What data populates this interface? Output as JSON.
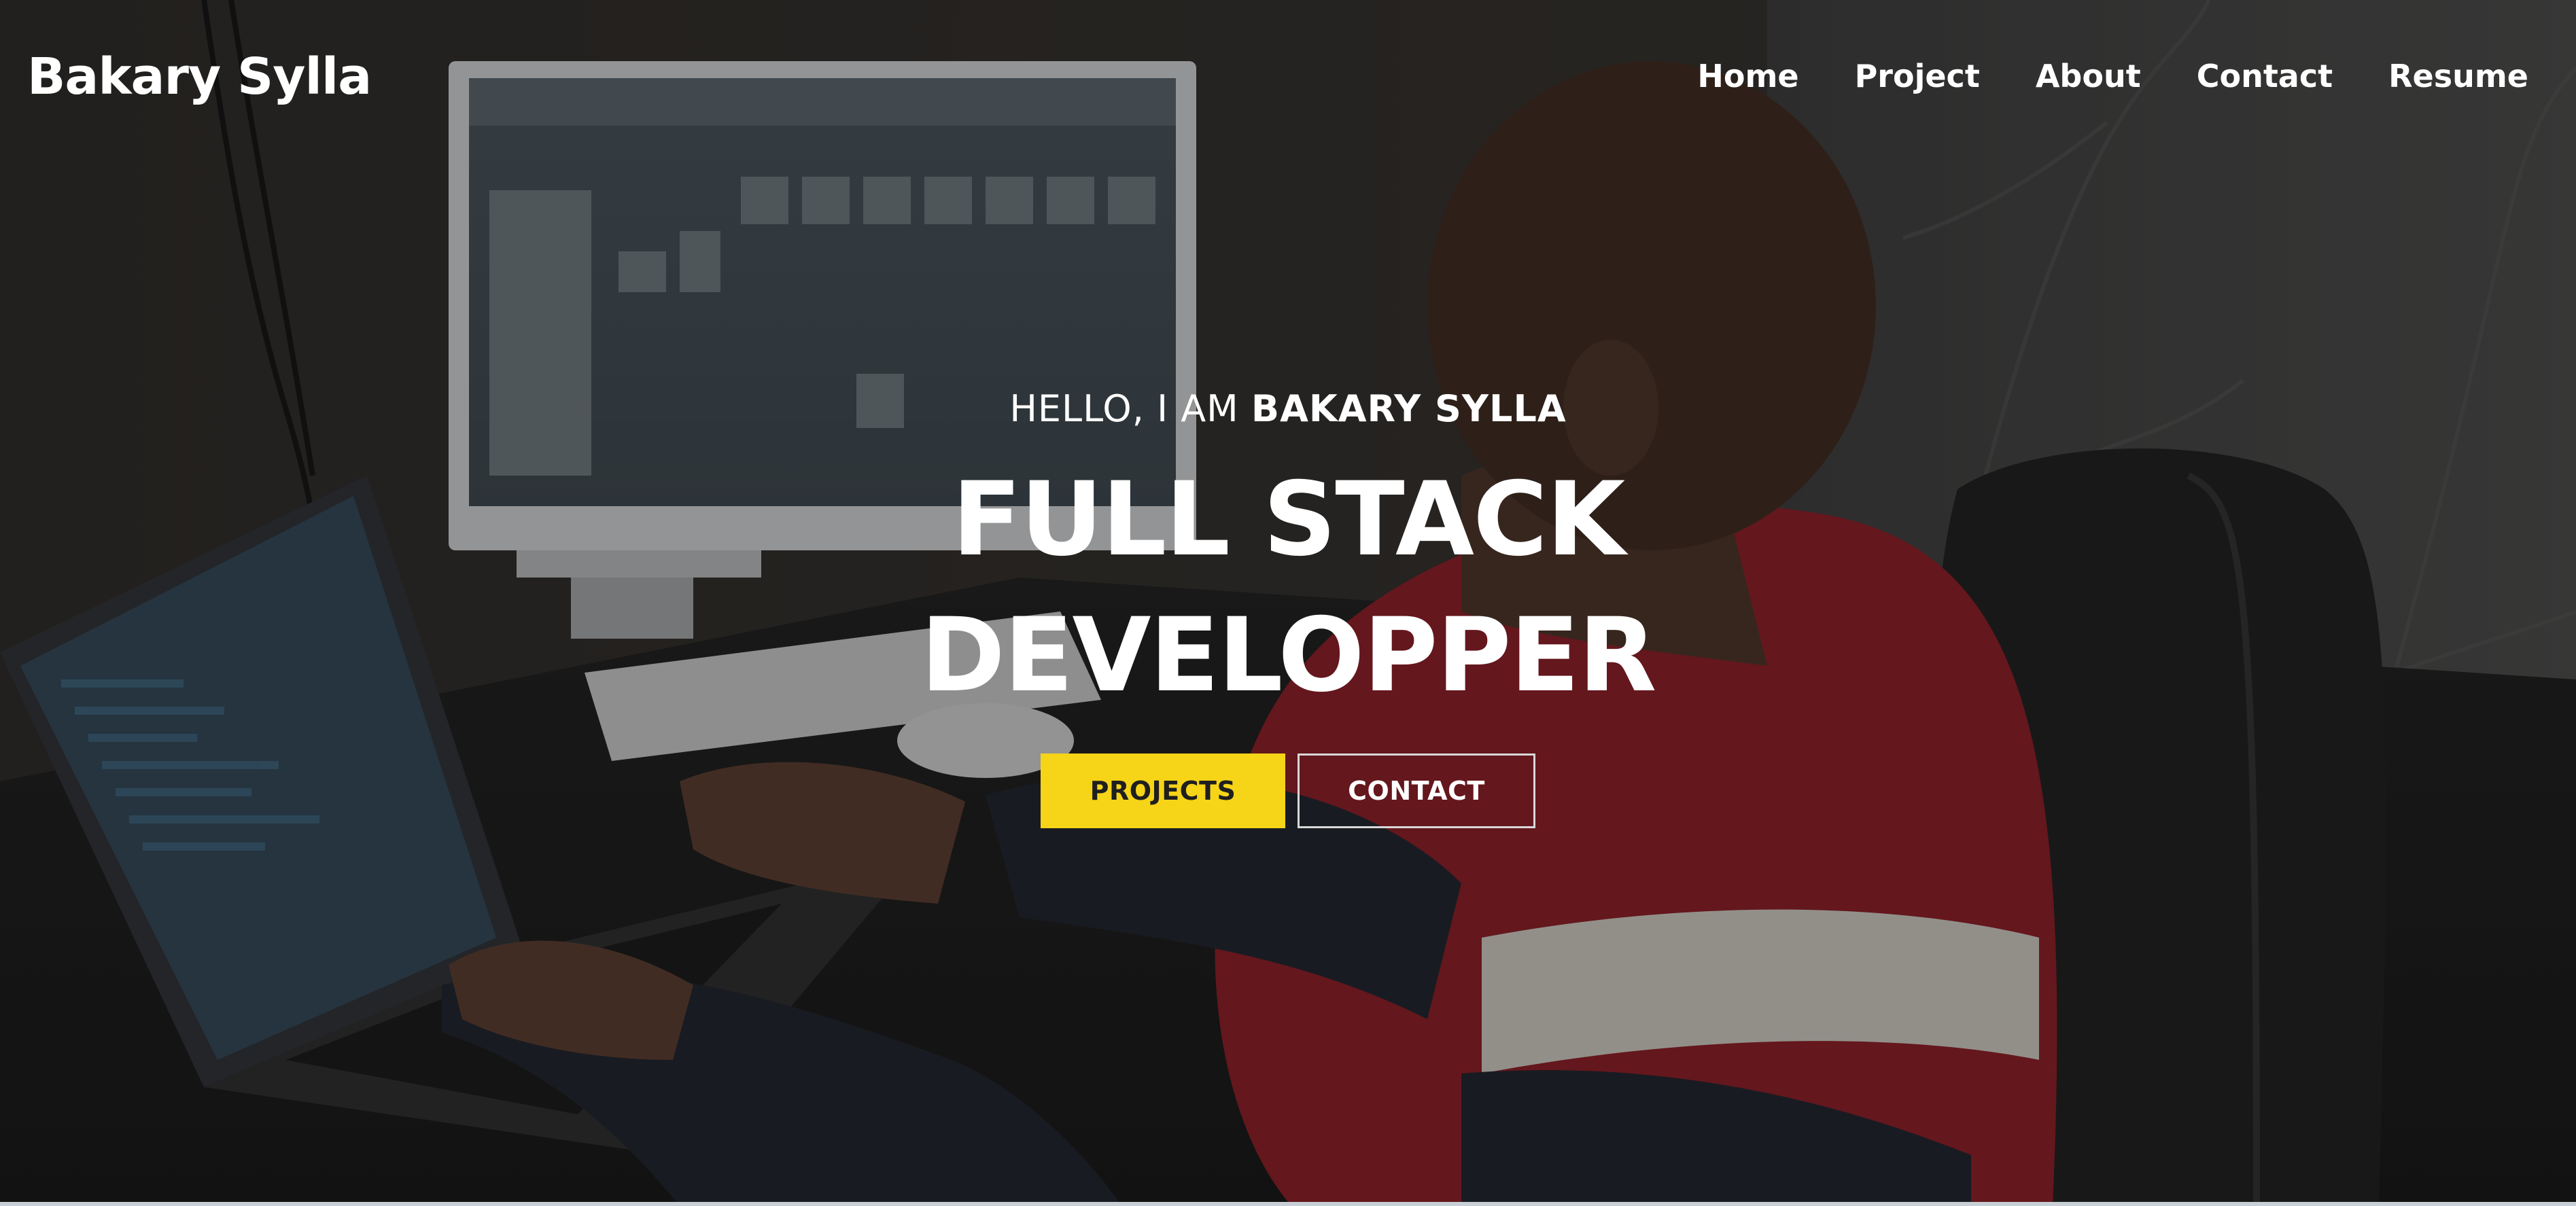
{
  "brand": {
    "name": "Bakary Sylla"
  },
  "nav": {
    "items": [
      {
        "label": "Home"
      },
      {
        "label": "Project"
      },
      {
        "label": "About"
      },
      {
        "label": "Contact"
      },
      {
        "label": "Resume"
      }
    ]
  },
  "hero": {
    "greeting_prefix": "HELLO, I AM ",
    "greeting_name": "BAKARY SYLLA",
    "headline_line1": "FULL STACK",
    "headline_line2": "DEVELOPPER",
    "primary_button": "PROJECTS",
    "secondary_button": "CONTACT"
  },
  "colors": {
    "accent": "#f6d417",
    "text": "#ffffff",
    "overlay": "#141414"
  }
}
